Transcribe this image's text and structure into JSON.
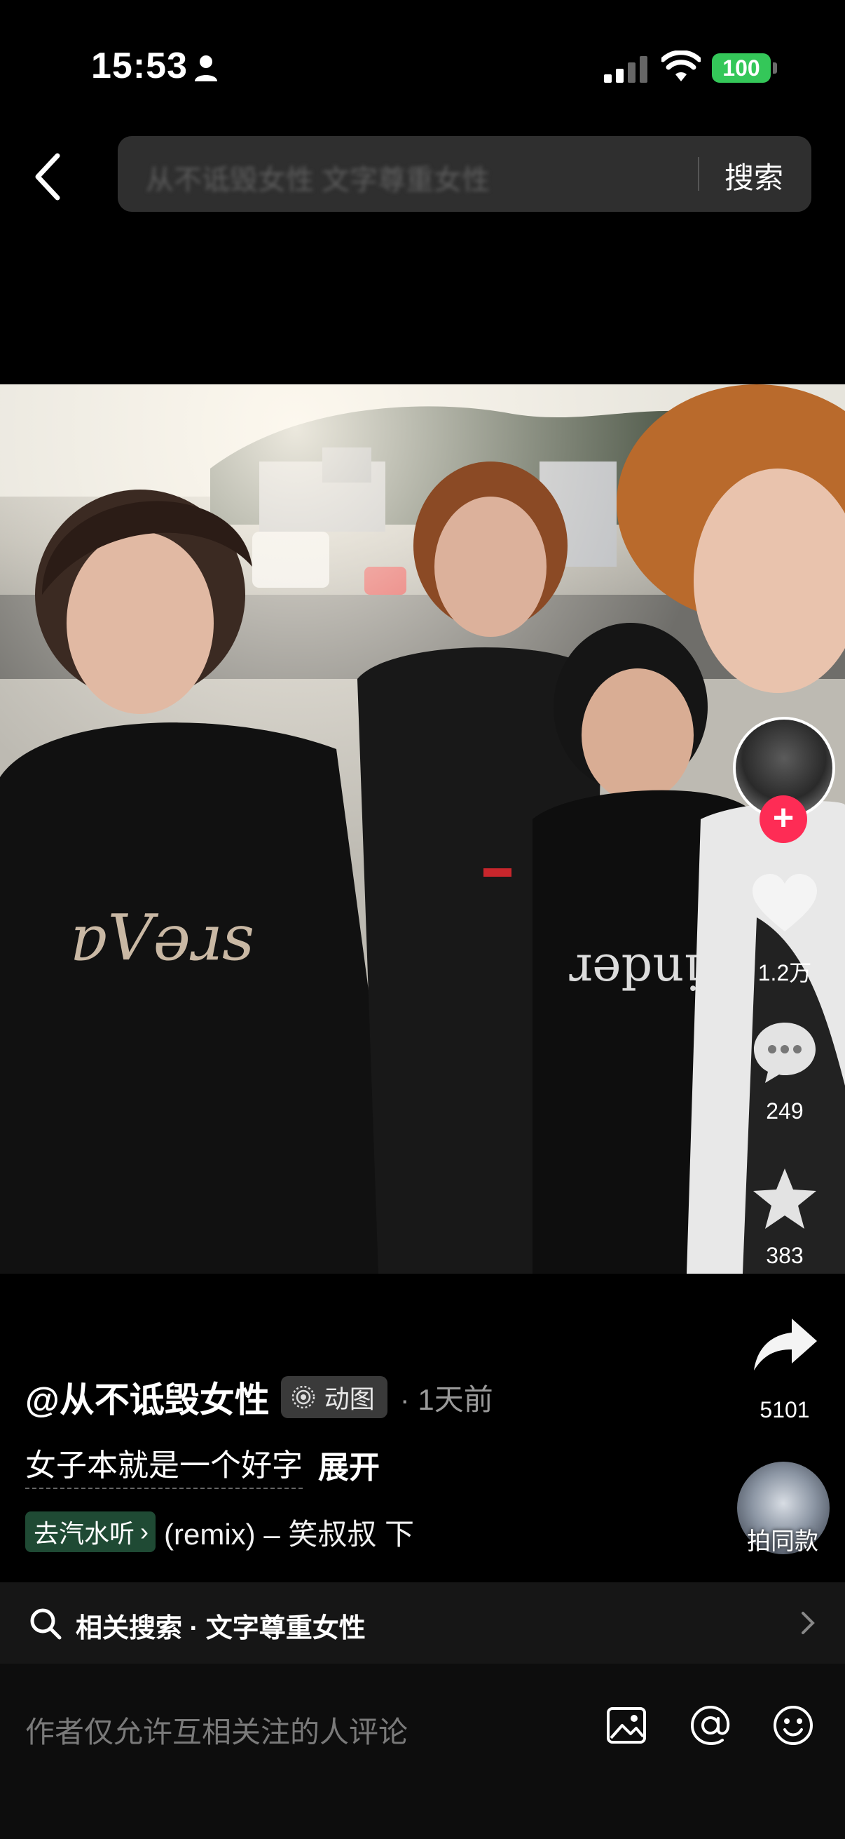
{
  "status_bar": {
    "time": "15:53",
    "battery": "100",
    "battery_color": "#34c759"
  },
  "header": {
    "search_placeholder": "从不诋毁女性 文字尊重女性",
    "search_button": "搜索"
  },
  "icons": {
    "back": "chevron-left-icon",
    "like": "heart-icon",
    "comment": "speech-bubble-icon",
    "favorite": "star-icon",
    "share": "share-arrow-icon",
    "related": "search-icon",
    "image": "image-icon",
    "mention": "at-icon",
    "emoji": "smiley-icon"
  },
  "actions": {
    "follow": "+",
    "like_count": "1.2万",
    "comment_count": "249",
    "favorite_count": "383",
    "share_count": "5101",
    "remix_label": "拍同款"
  },
  "post": {
    "author": "@从不诋毁女性",
    "badge": "动图",
    "time": "· 1天前",
    "caption": "女子本就是一个好字",
    "expand": "展开",
    "music_chip": "去汽水听",
    "music_title": "(remix) – 笑叔叔   下"
  },
  "related": {
    "text": "相关搜索 · 文字尊重女性"
  },
  "comment": {
    "placeholder": "作者仅允许互相关注的人评论"
  },
  "colors": {
    "accent_red": "#fe2c55",
    "music_chip": "#1f4a34"
  }
}
